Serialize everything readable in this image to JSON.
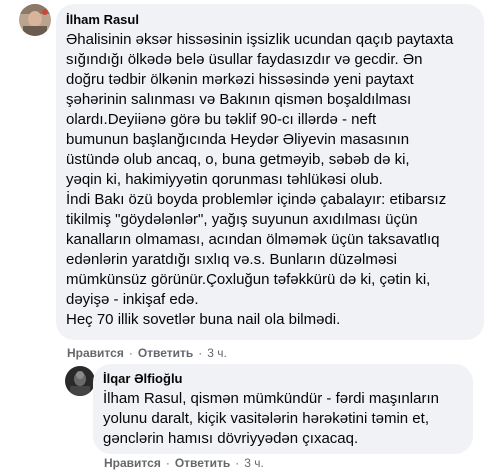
{
  "comment": {
    "author": "İlham Rasul",
    "lines": [
      "Əhalisinin əksər hissəsinin işsizlik ucundan qaçıb paytaxta",
      "sığındığı ölkədə belə üsullar faydasızdır və gecdir. Ən",
      "doğru tədbir ölkənin mərkəzi hissəsində yeni paytaxt",
      "şəhərinin salınması və Bakının qismən boşaldılması",
      "olardı.Deyiiənə görə bu təklif 90-cı illərdə - neft",
      "bumunun başlanğıcında Heydər Əliyevin masasının",
      "üstündə olub ancaq, o, buna getməyib, səbəb də ki,",
      "yəqin ki, hakimiyyətin qorunması təhlükəsi olub.",
      "İndi Bakı özü boyda problemlər içində çabalayır: etibarsız",
      "tikilmiş \"göydələnlər\", yağış suyunun axıdılması üçün",
      "kanalların olmaması, acından ölməmək üçün taksavatlıq",
      "edənlərin yaratdığı sıxlıq və.s. Bunların düzəlməsi",
      "mümkünsüz görünür.Çoxluğun təfəkkürü də ki, çətin ki,",
      "dəyişə - inkişaf edə.",
      "Heç 70 illik sovetlər buna nail ola bilmədi."
    ],
    "like_label": "Нравится",
    "reply_label": "Ответить",
    "time": "3 ч."
  },
  "reply": {
    "author": "İlqar Əlfioğlu",
    "lines": [
      "İlham Rasul, qismən mümkündür - fərdi maşınların",
      "yolunu daralt, kiçik vasitələrin hərəkətini təmin et,",
      "gənclərin hamısı dövriyyədən çıxacaq."
    ],
    "like_label": "Нравится",
    "reply_label": "Ответить",
    "time": "3 ч."
  },
  "icons": {
    "comment_avatar": "avatar-photo",
    "reply_avatar": "avatar-photo"
  },
  "colors": {
    "bubble": "#f0f2f5",
    "meta_text": "#65676b",
    "body_text": "#050505"
  }
}
